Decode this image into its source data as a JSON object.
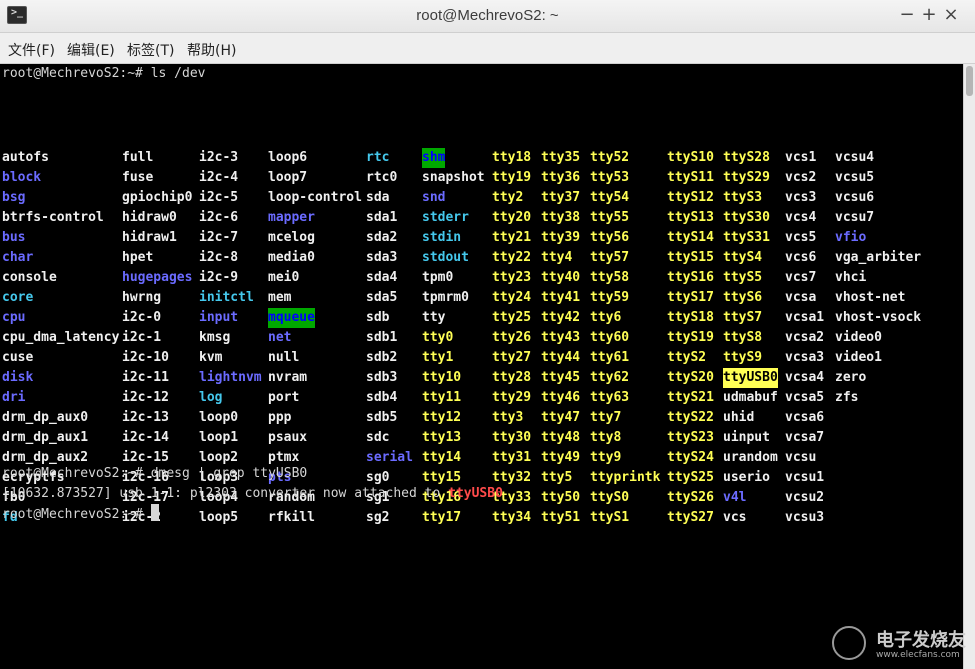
{
  "window": {
    "title": "root@MechrevoS2: ~",
    "minimize": "−",
    "maximize": "+",
    "close": "×",
    "app_icon": "terminal-icon"
  },
  "menubar": [
    {
      "label": "文件(F)"
    },
    {
      "label": "编辑(E)"
    },
    {
      "label": "标签(T)"
    },
    {
      "label": "帮助(H)"
    }
  ],
  "terminal": {
    "cmd1": "root@MechrevoS2:~# ls /dev",
    "cmd2": "root@MechrevoS2:~# dmesg | grep ttyUSB0",
    "dmesg_prefix": "[10632.873527] usb 1-1: pl2303 converter now attached to ",
    "dmesg_device": "ttyUSB0",
    "prompt": "root@MechrevoS2:~# ",
    "colors": {
      "regular": "#f0f0f0",
      "directory": "#6b6bff",
      "symlink": "#45c8ec",
      "device": "#ffff55",
      "sticky_dir_bg": "#00a800",
      "highlight_bg": "#ffff55",
      "match": "#ff4b4b"
    },
    "columns": [
      [
        {
          "text": "autofs",
          "c": "white"
        },
        {
          "text": "block",
          "c": "blue"
        },
        {
          "text": "bsg",
          "c": "blue"
        },
        {
          "text": "btrfs-control",
          "c": "white"
        },
        {
          "text": "bus",
          "c": "blue"
        },
        {
          "text": "char",
          "c": "blue"
        },
        {
          "text": "console",
          "c": "white"
        },
        {
          "text": "core",
          "c": "cyan"
        },
        {
          "text": "cpu",
          "c": "blue"
        },
        {
          "text": "cpu_dma_latency",
          "c": "white"
        },
        {
          "text": "cuse",
          "c": "white"
        },
        {
          "text": "disk",
          "c": "blue"
        },
        {
          "text": "dri",
          "c": "blue"
        },
        {
          "text": "drm_dp_aux0",
          "c": "white"
        },
        {
          "text": "drm_dp_aux1",
          "c": "white"
        },
        {
          "text": "drm_dp_aux2",
          "c": "white"
        },
        {
          "text": "ecryptfs",
          "c": "white"
        },
        {
          "text": "fb0",
          "c": "white"
        },
        {
          "text": "fd",
          "c": "cyan"
        }
      ],
      [
        {
          "text": "full",
          "c": "white"
        },
        {
          "text": "fuse",
          "c": "white"
        },
        {
          "text": "gpiochip0",
          "c": "white"
        },
        {
          "text": "hidraw0",
          "c": "white"
        },
        {
          "text": "hidraw1",
          "c": "white"
        },
        {
          "text": "hpet",
          "c": "white"
        },
        {
          "text": "hugepages",
          "c": "blue"
        },
        {
          "text": "hwrng",
          "c": "white"
        },
        {
          "text": "i2c-0",
          "c": "white"
        },
        {
          "text": "i2c-1",
          "c": "white"
        },
        {
          "text": "i2c-10",
          "c": "white"
        },
        {
          "text": "i2c-11",
          "c": "white"
        },
        {
          "text": "i2c-12",
          "c": "white"
        },
        {
          "text": "i2c-13",
          "c": "white"
        },
        {
          "text": "i2c-14",
          "c": "white"
        },
        {
          "text": "i2c-15",
          "c": "white"
        },
        {
          "text": "i2c-16",
          "c": "white"
        },
        {
          "text": "i2c-17",
          "c": "white"
        },
        {
          "text": "i2c-2",
          "c": "white"
        }
      ],
      [
        {
          "text": "i2c-3",
          "c": "white"
        },
        {
          "text": "i2c-4",
          "c": "white"
        },
        {
          "text": "i2c-5",
          "c": "white"
        },
        {
          "text": "i2c-6",
          "c": "white"
        },
        {
          "text": "i2c-7",
          "c": "white"
        },
        {
          "text": "i2c-8",
          "c": "white"
        },
        {
          "text": "i2c-9",
          "c": "white"
        },
        {
          "text": "initctl",
          "c": "cyan"
        },
        {
          "text": "input",
          "c": "blue"
        },
        {
          "text": "kmsg",
          "c": "white"
        },
        {
          "text": "kvm",
          "c": "white"
        },
        {
          "text": "lightnvm",
          "c": "blue"
        },
        {
          "text": "log",
          "c": "cyan"
        },
        {
          "text": "loop0",
          "c": "white"
        },
        {
          "text": "loop1",
          "c": "white"
        },
        {
          "text": "loop2",
          "c": "white"
        },
        {
          "text": "loop3",
          "c": "white"
        },
        {
          "text": "loop4",
          "c": "white"
        },
        {
          "text": "loop5",
          "c": "white"
        }
      ],
      [
        {
          "text": "loop6",
          "c": "white"
        },
        {
          "text": "loop7",
          "c": "white"
        },
        {
          "text": "loop-control",
          "c": "white"
        },
        {
          "text": "mapper",
          "c": "blue"
        },
        {
          "text": "mcelog",
          "c": "white"
        },
        {
          "text": "media0",
          "c": "white"
        },
        {
          "text": "mei0",
          "c": "white"
        },
        {
          "text": "mem",
          "c": "white"
        },
        {
          "text": "mqueue",
          "c": "hl-green"
        },
        {
          "text": "net",
          "c": "blue"
        },
        {
          "text": "null",
          "c": "white"
        },
        {
          "text": "nvram",
          "c": "white"
        },
        {
          "text": "port",
          "c": "white"
        },
        {
          "text": "ppp",
          "c": "white"
        },
        {
          "text": "psaux",
          "c": "white"
        },
        {
          "text": "ptmx",
          "c": "white"
        },
        {
          "text": "pts",
          "c": "blue"
        },
        {
          "text": "random",
          "c": "white"
        },
        {
          "text": "rfkill",
          "c": "white"
        }
      ],
      [
        {
          "text": "rtc",
          "c": "cyan"
        },
        {
          "text": "rtc0",
          "c": "white"
        },
        {
          "text": "sda",
          "c": "white"
        },
        {
          "text": "sda1",
          "c": "white"
        },
        {
          "text": "sda2",
          "c": "white"
        },
        {
          "text": "sda3",
          "c": "white"
        },
        {
          "text": "sda4",
          "c": "white"
        },
        {
          "text": "sda5",
          "c": "white"
        },
        {
          "text": "sdb",
          "c": "white"
        },
        {
          "text": "sdb1",
          "c": "white"
        },
        {
          "text": "sdb2",
          "c": "white"
        },
        {
          "text": "sdb3",
          "c": "white"
        },
        {
          "text": "sdb4",
          "c": "white"
        },
        {
          "text": "sdb5",
          "c": "white"
        },
        {
          "text": "sdc",
          "c": "white"
        },
        {
          "text": "serial",
          "c": "blue"
        },
        {
          "text": "sg0",
          "c": "white"
        },
        {
          "text": "sg1",
          "c": "white"
        },
        {
          "text": "sg2",
          "c": "white"
        }
      ],
      [
        {
          "text": "shm",
          "c": "hl-green"
        },
        {
          "text": "snapshot",
          "c": "white"
        },
        {
          "text": "snd",
          "c": "blue"
        },
        {
          "text": "stderr",
          "c": "cyan"
        },
        {
          "text": "stdin",
          "c": "cyan"
        },
        {
          "text": "stdout",
          "c": "cyan"
        },
        {
          "text": "tpm0",
          "c": "white"
        },
        {
          "text": "tpmrm0",
          "c": "white"
        },
        {
          "text": "tty",
          "c": "white"
        },
        {
          "text": "tty0",
          "c": "yellow"
        },
        {
          "text": "tty1",
          "c": "yellow"
        },
        {
          "text": "tty10",
          "c": "yellow"
        },
        {
          "text": "tty11",
          "c": "yellow"
        },
        {
          "text": "tty12",
          "c": "yellow"
        },
        {
          "text": "tty13",
          "c": "yellow"
        },
        {
          "text": "tty14",
          "c": "yellow"
        },
        {
          "text": "tty15",
          "c": "yellow"
        },
        {
          "text": "tty16",
          "c": "yellow"
        },
        {
          "text": "tty17",
          "c": "yellow"
        }
      ],
      [
        {
          "text": "tty18",
          "c": "yellow"
        },
        {
          "text": "tty19",
          "c": "yellow"
        },
        {
          "text": "tty2",
          "c": "yellow"
        },
        {
          "text": "tty20",
          "c": "yellow"
        },
        {
          "text": "tty21",
          "c": "yellow"
        },
        {
          "text": "tty22",
          "c": "yellow"
        },
        {
          "text": "tty23",
          "c": "yellow"
        },
        {
          "text": "tty24",
          "c": "yellow"
        },
        {
          "text": "tty25",
          "c": "yellow"
        },
        {
          "text": "tty26",
          "c": "yellow"
        },
        {
          "text": "tty27",
          "c": "yellow"
        },
        {
          "text": "tty28",
          "c": "yellow"
        },
        {
          "text": "tty29",
          "c": "yellow"
        },
        {
          "text": "tty3",
          "c": "yellow"
        },
        {
          "text": "tty30",
          "c": "yellow"
        },
        {
          "text": "tty31",
          "c": "yellow"
        },
        {
          "text": "tty32",
          "c": "yellow"
        },
        {
          "text": "tty33",
          "c": "yellow"
        },
        {
          "text": "tty34",
          "c": "yellow"
        }
      ],
      [
        {
          "text": "tty35",
          "c": "yellow"
        },
        {
          "text": "tty36",
          "c": "yellow"
        },
        {
          "text": "tty37",
          "c": "yellow"
        },
        {
          "text": "tty38",
          "c": "yellow"
        },
        {
          "text": "tty39",
          "c": "yellow"
        },
        {
          "text": "tty4",
          "c": "yellow"
        },
        {
          "text": "tty40",
          "c": "yellow"
        },
        {
          "text": "tty41",
          "c": "yellow"
        },
        {
          "text": "tty42",
          "c": "yellow"
        },
        {
          "text": "tty43",
          "c": "yellow"
        },
        {
          "text": "tty44",
          "c": "yellow"
        },
        {
          "text": "tty45",
          "c": "yellow"
        },
        {
          "text": "tty46",
          "c": "yellow"
        },
        {
          "text": "tty47",
          "c": "yellow"
        },
        {
          "text": "tty48",
          "c": "yellow"
        },
        {
          "text": "tty49",
          "c": "yellow"
        },
        {
          "text": "tty5",
          "c": "yellow"
        },
        {
          "text": "tty50",
          "c": "yellow"
        },
        {
          "text": "tty51",
          "c": "yellow"
        }
      ],
      [
        {
          "text": "tty52",
          "c": "yellow"
        },
        {
          "text": "tty53",
          "c": "yellow"
        },
        {
          "text": "tty54",
          "c": "yellow"
        },
        {
          "text": "tty55",
          "c": "yellow"
        },
        {
          "text": "tty56",
          "c": "yellow"
        },
        {
          "text": "tty57",
          "c": "yellow"
        },
        {
          "text": "tty58",
          "c": "yellow"
        },
        {
          "text": "tty59",
          "c": "yellow"
        },
        {
          "text": "tty6",
          "c": "yellow"
        },
        {
          "text": "tty60",
          "c": "yellow"
        },
        {
          "text": "tty61",
          "c": "yellow"
        },
        {
          "text": "tty62",
          "c": "yellow"
        },
        {
          "text": "tty63",
          "c": "yellow"
        },
        {
          "text": "tty7",
          "c": "yellow"
        },
        {
          "text": "tty8",
          "c": "yellow"
        },
        {
          "text": "tty9",
          "c": "yellow"
        },
        {
          "text": "ttyprintk",
          "c": "yellow"
        },
        {
          "text": "ttyS0",
          "c": "yellow"
        },
        {
          "text": "ttyS1",
          "c": "yellow"
        }
      ],
      [
        {
          "text": "ttyS10",
          "c": "yellow"
        },
        {
          "text": "ttyS11",
          "c": "yellow"
        },
        {
          "text": "ttyS12",
          "c": "yellow"
        },
        {
          "text": "ttyS13",
          "c": "yellow"
        },
        {
          "text": "ttyS14",
          "c": "yellow"
        },
        {
          "text": "ttyS15",
          "c": "yellow"
        },
        {
          "text": "ttyS16",
          "c": "yellow"
        },
        {
          "text": "ttyS17",
          "c": "yellow"
        },
        {
          "text": "ttyS18",
          "c": "yellow"
        },
        {
          "text": "ttyS19",
          "c": "yellow"
        },
        {
          "text": "ttyS2",
          "c": "yellow"
        },
        {
          "text": "ttyS20",
          "c": "yellow"
        },
        {
          "text": "ttyS21",
          "c": "yellow"
        },
        {
          "text": "ttyS22",
          "c": "yellow"
        },
        {
          "text": "ttyS23",
          "c": "yellow"
        },
        {
          "text": "ttyS24",
          "c": "yellow"
        },
        {
          "text": "ttyS25",
          "c": "yellow"
        },
        {
          "text": "ttyS26",
          "c": "yellow"
        },
        {
          "text": "ttyS27",
          "c": "yellow"
        }
      ],
      [
        {
          "text": "ttyS28",
          "c": "yellow"
        },
        {
          "text": "ttyS29",
          "c": "yellow"
        },
        {
          "text": "ttyS3",
          "c": "yellow"
        },
        {
          "text": "ttyS30",
          "c": "yellow"
        },
        {
          "text": "ttyS31",
          "c": "yellow"
        },
        {
          "text": "ttyS4",
          "c": "yellow"
        },
        {
          "text": "ttyS5",
          "c": "yellow"
        },
        {
          "text": "ttyS6",
          "c": "yellow"
        },
        {
          "text": "ttyS7",
          "c": "yellow"
        },
        {
          "text": "ttyS8",
          "c": "yellow"
        },
        {
          "text": "ttyS9",
          "c": "yellow"
        },
        {
          "text": "ttyUSB0",
          "c": "hl-yellow"
        },
        {
          "text": "udmabuf",
          "c": "white"
        },
        {
          "text": "uhid",
          "c": "white"
        },
        {
          "text": "uinput",
          "c": "white"
        },
        {
          "text": "urandom",
          "c": "white"
        },
        {
          "text": "userio",
          "c": "white"
        },
        {
          "text": "v4l",
          "c": "blue"
        },
        {
          "text": "vcs",
          "c": "white"
        }
      ],
      [
        {
          "text": "vcs1",
          "c": "white"
        },
        {
          "text": "vcs2",
          "c": "white"
        },
        {
          "text": "vcs3",
          "c": "white"
        },
        {
          "text": "vcs4",
          "c": "white"
        },
        {
          "text": "vcs5",
          "c": "white"
        },
        {
          "text": "vcs6",
          "c": "white"
        },
        {
          "text": "vcs7",
          "c": "white"
        },
        {
          "text": "vcsa",
          "c": "white"
        },
        {
          "text": "vcsa1",
          "c": "white"
        },
        {
          "text": "vcsa2",
          "c": "white"
        },
        {
          "text": "vcsa3",
          "c": "white"
        },
        {
          "text": "vcsa4",
          "c": "white"
        },
        {
          "text": "vcsa5",
          "c": "white"
        },
        {
          "text": "vcsa6",
          "c": "white"
        },
        {
          "text": "vcsa7",
          "c": "white"
        },
        {
          "text": "vcsu",
          "c": "white"
        },
        {
          "text": "vcsu1",
          "c": "white"
        },
        {
          "text": "vcsu2",
          "c": "white"
        },
        {
          "text": "vcsu3",
          "c": "white"
        }
      ],
      [
        {
          "text": "vcsu4",
          "c": "white"
        },
        {
          "text": "vcsu5",
          "c": "white"
        },
        {
          "text": "vcsu6",
          "c": "white"
        },
        {
          "text": "vcsu7",
          "c": "white"
        },
        {
          "text": "vfio",
          "c": "blue"
        },
        {
          "text": "vga_arbiter",
          "c": "white"
        },
        {
          "text": "vhci",
          "c": "white"
        },
        {
          "text": "vhost-net",
          "c": "white"
        },
        {
          "text": "vhost-vsock",
          "c": "white"
        },
        {
          "text": "video0",
          "c": "white"
        },
        {
          "text": "video1",
          "c": "white"
        },
        {
          "text": "zero",
          "c": "white"
        },
        {
          "text": "zfs",
          "c": "white"
        }
      ]
    ]
  },
  "watermark": {
    "cn": "电子发烧友",
    "en": "www.elecfans.com"
  }
}
